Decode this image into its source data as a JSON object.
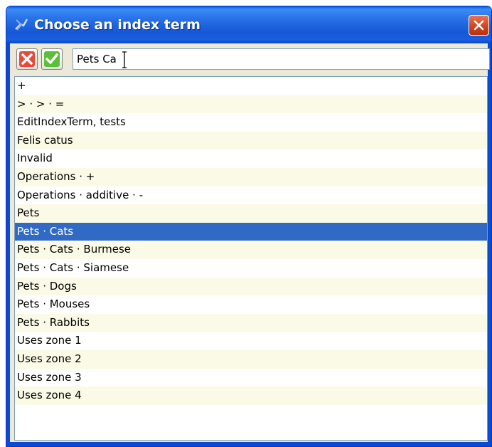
{
  "window": {
    "title": "Choose an index term",
    "icon": "app-icon",
    "close_icon": "close-icon"
  },
  "toolbar": {
    "cancel_icon": "cancel-x-icon",
    "ok_icon": "checkmark-icon",
    "search_value": "Pets Ca"
  },
  "list": {
    "selected_index": 8,
    "items": [
      "+",
      "> · > · =",
      "EditIndexTerm, tests",
      "Felis catus",
      "Invalid",
      "Operations · +",
      "Operations · additive · -",
      "Pets",
      "Pets · Cats",
      "Pets · Cats · Burmese",
      "Pets · Cats · Siamese",
      "Pets · Dogs",
      "Pets · Mouses",
      "Pets · Rabbits",
      "Uses zone 1",
      "Uses zone 2",
      "Uses zone 3",
      "Uses zone 4"
    ]
  },
  "colors": {
    "title_bar": "#1657d6",
    "selection": "#316ac5",
    "alt_row": "#fafae6"
  }
}
